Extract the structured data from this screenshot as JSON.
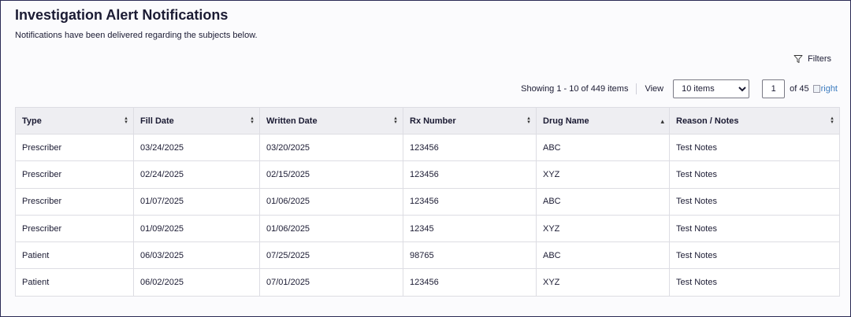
{
  "page": {
    "title": "Investigation Alert Notifications",
    "subtitle": "Notifications have been delivered regarding the subjects below."
  },
  "filters": {
    "label": "Filters",
    "icon": "filter-icon"
  },
  "pager": {
    "showing": "Showing 1 - 10 of 449 items",
    "view_label": "View",
    "view_selected": "10 items",
    "page_current": "1",
    "page_total": "of 45",
    "next_alt": "right"
  },
  "table": {
    "columns": [
      "Type",
      "Fill Date",
      "Written Date",
      "Rx Number",
      "Drug Name",
      "Reason / Notes"
    ],
    "sort_icons": [
      "both",
      "both",
      "both",
      "both",
      "up",
      "both"
    ],
    "rows": [
      [
        "Prescriber",
        "03/24/2025",
        "03/20/2025",
        "123456",
        "ABC",
        "Test Notes"
      ],
      [
        "Prescriber",
        "02/24/2025",
        "02/15/2025",
        "123456",
        "XYZ",
        "Test Notes"
      ],
      [
        "Prescriber",
        "01/07/2025",
        "01/06/2025",
        "123456",
        "ABC",
        "Test Notes"
      ],
      [
        "Prescriber",
        "01/09/2025",
        "01/06/2025",
        "12345",
        "XYZ",
        "Test Notes"
      ],
      [
        "Patient",
        "06/03/2025",
        "07/25/2025",
        "98765",
        "ABC",
        "Test Notes"
      ],
      [
        "Patient",
        "06/02/2025",
        "07/01/2025",
        "123456",
        "XYZ",
        "Test Notes"
      ]
    ]
  }
}
